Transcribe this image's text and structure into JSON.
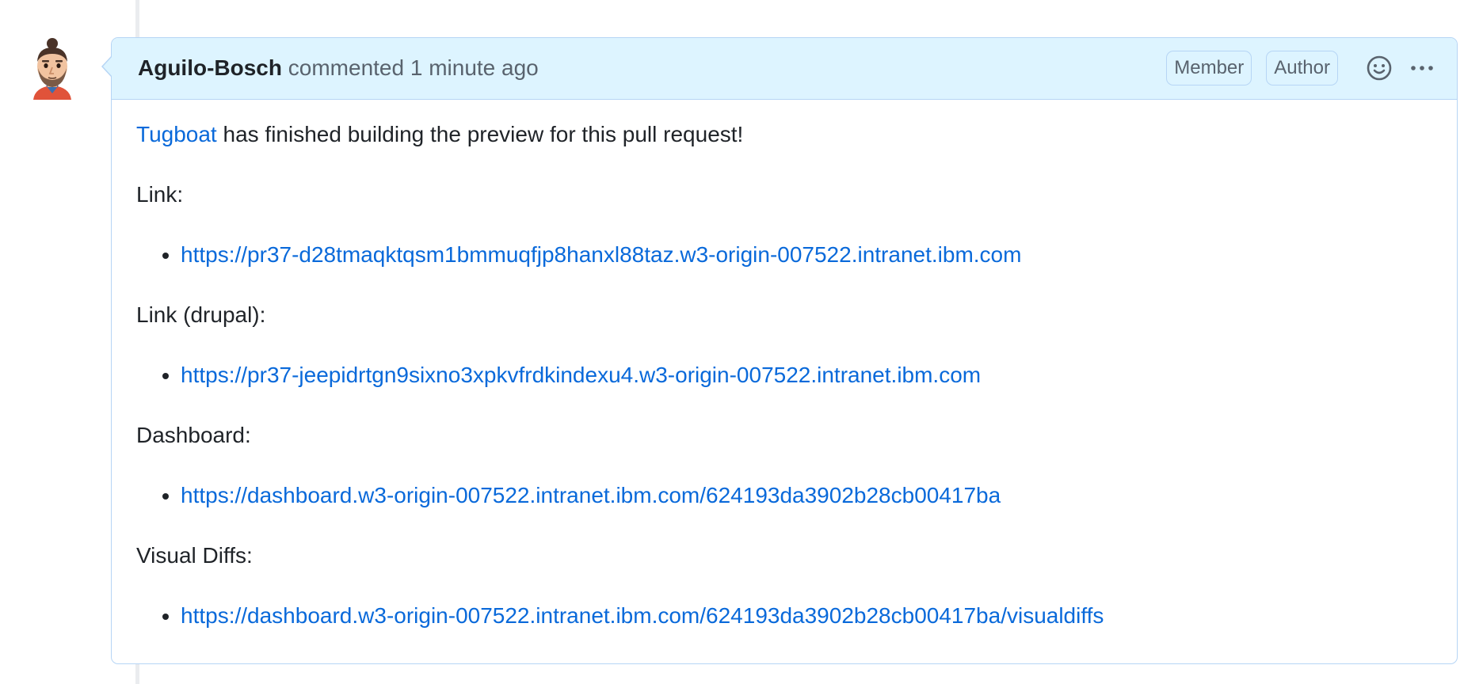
{
  "comment": {
    "author": "Aguilo-Bosch",
    "action": "commented",
    "time": "1 minute ago",
    "badges": {
      "member": "Member",
      "author": "Author"
    },
    "icons": {
      "reaction": "smiley-icon",
      "more": "kebab-horizontal-icon"
    },
    "body": {
      "intro_link": "Tugboat",
      "intro_text": " has finished building the preview for this pull request!",
      "sections": [
        {
          "label": "Link:",
          "url": "https://pr37-d28tmaqktqsm1bmmuqfjp8hanxl88taz.w3-origin-007522.intranet.ibm.com"
        },
        {
          "label": "Link (drupal):",
          "url": "https://pr37-jeepidrtgn9sixno3xpkvfrdkindexu4.w3-origin-007522.intranet.ibm.com"
        },
        {
          "label": "Dashboard:",
          "url": "https://dashboard.w3-origin-007522.intranet.ibm.com/624193da3902b28cb00417ba"
        },
        {
          "label": "Visual Diffs:",
          "url": "https://dashboard.w3-origin-007522.intranet.ibm.com/624193da3902b28cb00417ba/visualdiffs"
        }
      ]
    }
  },
  "colors": {
    "header_bg": "#ddf4ff",
    "border": "#b6d5f5",
    "link": "#0969da",
    "text": "#1f2328",
    "muted": "#59636e"
  }
}
